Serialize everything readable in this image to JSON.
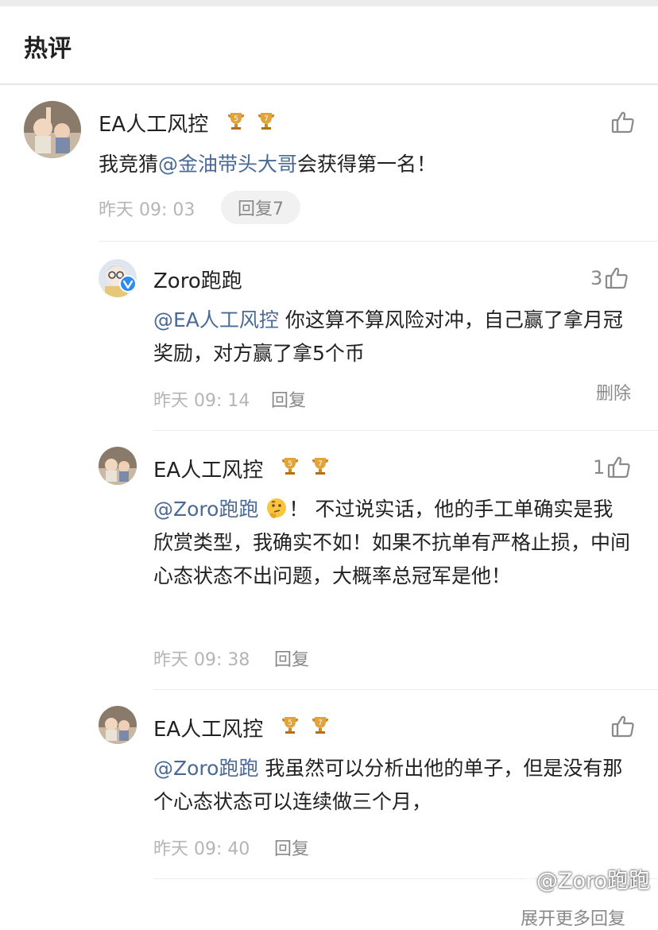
{
  "header": {
    "title": "热评"
  },
  "comments": [
    {
      "user": "EA人工风控",
      "badges": [
        "5",
        "7"
      ],
      "text_pre": "我竞猜",
      "mention": "@金油带头大哥",
      "text_post": "会获得第一名！",
      "time": "昨天 09: 03",
      "reply_label": "回复7",
      "likes": ""
    }
  ],
  "replies": [
    {
      "user": "Zoro跑跑",
      "verified": true,
      "likes": "3",
      "mention": "@EA人工风控",
      "text": " 你这算不算风险对冲，自己赢了拿月冠奖励，对方赢了拿5个币",
      "time": "昨天 09: 14",
      "reply_label": "回复",
      "delete_label": "删除"
    },
    {
      "user": "EA人工风控",
      "badges": [
        "5",
        "7"
      ],
      "likes": "1",
      "mention": "@Zoro跑跑",
      "emoji": "thinking-face",
      "text": "！ 不过说实话，他的手工单确实是我欣赏类型，我确实不如！如果不抗单有严格止损，中间心态状态不出问题，大概率总冠军是他！",
      "time": "昨天 09: 38",
      "reply_label": "回复"
    },
    {
      "user": "EA人工风控",
      "badges": [
        "5",
        "7"
      ],
      "likes": "",
      "mention": "@Zoro跑跑",
      "text": " 我虽然可以分析出他的单子，但是没有那个心态状态可以连续做三个月，",
      "time": "昨天 09: 40",
      "reply_label": "回复"
    }
  ],
  "footer": {
    "watermark": "@Zoro跑跑",
    "more_replies": "展开更多回复"
  },
  "colors": {
    "mention": "#4a6a95",
    "badge_gold": "#e2a33a",
    "meta_gray": "#b5b5b5"
  },
  "icons": [
    "thumbs-up-icon",
    "trophy-badge-icon",
    "verified-icon",
    "thinking-face-emoji",
    "weibo-logo-icon"
  ]
}
